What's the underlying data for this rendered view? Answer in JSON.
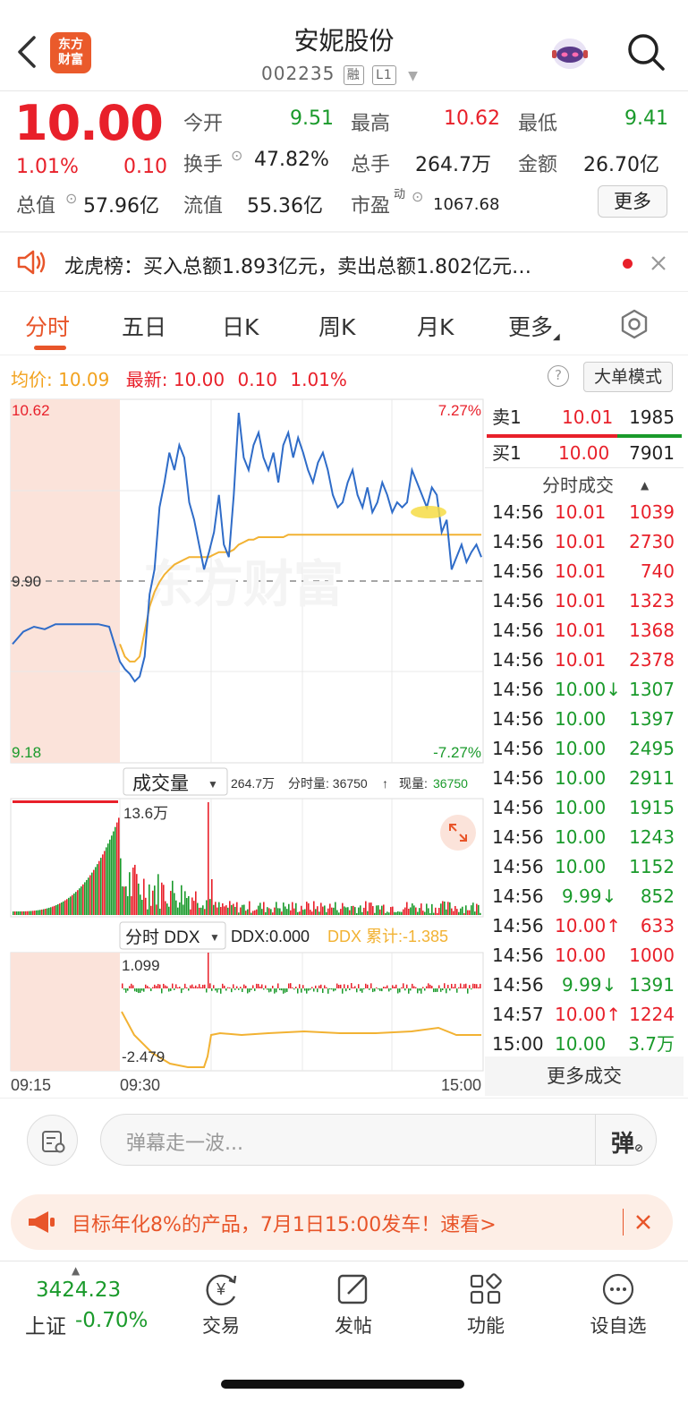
{
  "header": {
    "stock_name": "安妮股份",
    "stock_code": "002235",
    "tag_margin": "融",
    "tag_level": "L1",
    "logo_line1": "东方",
    "logo_line2": "财富"
  },
  "quote": {
    "price": "10.00",
    "change_pct": "1.01%",
    "change_amt": "0.10",
    "open_label": "今开",
    "open": "9.51",
    "high_label": "最高",
    "high": "10.62",
    "low_label": "最低",
    "low": "9.41",
    "turnover_label": "换手",
    "turnover": "47.82%",
    "volume_label": "总手",
    "volume": "264.7万",
    "amount_label": "金额",
    "amount": "26.70亿",
    "mcap_label": "总值",
    "mcap": "57.96亿",
    "float_label": "流值",
    "float_cap": "55.36亿",
    "pe_label": "市盈",
    "pe_sup": "动",
    "pe": "1067.68",
    "more_label": "更多"
  },
  "news": {
    "text": "龙虎榜：买入总额1.893亿元，卖出总额1.802亿元…"
  },
  "tabs": [
    "分时",
    "五日",
    "日K",
    "周K",
    "月K",
    "更多"
  ],
  "active_tab": "分时",
  "avg_line": {
    "avg_label": "均价:",
    "avg": "10.09",
    "last_label": "最新:",
    "last": "10.00",
    "chg": "0.10",
    "pct": "1.01%",
    "help": "?",
    "big_mode": "大单模式"
  },
  "chart_data": [
    {
      "type": "line",
      "title": "分时",
      "y_left_ticks": [
        "10.62",
        "9.90",
        "9.18"
      ],
      "y_right_ticks": [
        "7.27%",
        "-7.27%"
      ],
      "x_ticks": [
        "09:15",
        "09:30",
        "15:00"
      ],
      "ylim": [
        9.18,
        10.62
      ],
      "prev_close": 9.9,
      "series": [
        {
          "values": [
            9.65,
            9.7,
            9.72,
            9.71,
            9.73,
            9.73,
            9.73,
            9.73,
            9.73,
            9.72,
            9.58,
            9.55,
            9.53,
            9.5,
            9.52,
            9.6,
            9.85,
            9.95,
            10.2,
            10.3,
            10.42,
            10.35,
            10.45,
            10.4,
            10.22,
            10.15,
            10.05,
            9.95,
            10.02,
            10.1,
            10.25,
            10.05,
            10.0,
            10.25,
            10.58,
            10.4,
            10.35,
            10.45,
            10.5,
            10.4,
            10.35,
            10.42,
            10.3,
            10.45,
            10.5,
            10.4,
            10.48,
            10.42,
            10.35,
            10.3,
            10.38,
            10.42,
            10.35,
            10.25,
            10.2,
            10.22,
            10.3,
            10.35,
            10.25,
            10.2,
            10.28,
            10.18,
            10.22,
            10.3,
            10.25,
            10.18,
            10.22,
            10.2,
            10.22,
            10.35,
            10.3,
            10.25,
            10.2,
            10.28,
            10.25,
            10.1,
            10.15,
            9.95,
            10.0,
            10.05,
            9.98,
            10.02,
            10.05,
            10.0
          ]
        },
        {
          "values": [
            9.65,
            9.7,
            9.72,
            9.72,
            9.72,
            9.72,
            9.72,
            9.72,
            9.72,
            9.72,
            9.65,
            9.6,
            9.58,
            9.58,
            9.6,
            9.7,
            9.8,
            9.86,
            9.9,
            9.93,
            9.95,
            9.97,
            9.98,
            9.99,
            10.0,
            10.0,
            10.0,
            10.0,
            10.0,
            10.01,
            10.02,
            10.02,
            10.02,
            10.03,
            10.05,
            10.06,
            10.07,
            10.07,
            10.08,
            10.08,
            10.08,
            10.08,
            10.08,
            10.08,
            10.09,
            10.09,
            10.09,
            10.09,
            10.09,
            10.09,
            10.09,
            10.09,
            10.09,
            10.09,
            10.09,
            10.09,
            10.09,
            10.09,
            10.09,
            10.09,
            10.09,
            10.09,
            10.09,
            10.09,
            10.09,
            10.09,
            10.09,
            10.09,
            10.09,
            10.09,
            10.09,
            10.09,
            10.09,
            10.09,
            10.09,
            10.09,
            10.09,
            10.09,
            10.09,
            10.09,
            10.09,
            10.09,
            10.09,
            10.09
          ]
        }
      ]
    },
    {
      "type": "bar",
      "title": "成交量",
      "label_total": "264.7万",
      "label_minute": "分时量: 36750",
      "label_now": "现量:",
      "now_value": "36750",
      "y_max_label": "13.6万",
      "ylim": [
        0,
        13.6
      ]
    },
    {
      "type": "line",
      "title": "分时 DDX",
      "ddx_label": "DDX:0.000",
      "ddx_cum_label": "DDX 累计:-1.385",
      "y_max_label": "1.099",
      "y_min_label": "-2.479",
      "ylim": [
        -2.479,
        1.099
      ]
    }
  ],
  "orderbook": {
    "sell_label": "卖1",
    "sell_price": "10.01",
    "sell_vol": "1985",
    "buy_label": "买1",
    "buy_price": "10.00",
    "buy_vol": "7901",
    "trades_title": "分时成交",
    "more_trades": "更多成交",
    "trades": [
      {
        "time": "14:56",
        "price": "10.01",
        "arrow": "",
        "vol": "1039",
        "color": "red"
      },
      {
        "time": "14:56",
        "price": "10.01",
        "arrow": "",
        "vol": "2730",
        "color": "red"
      },
      {
        "time": "14:56",
        "price": "10.01",
        "arrow": "",
        "vol": "740",
        "color": "red"
      },
      {
        "time": "14:56",
        "price": "10.01",
        "arrow": "",
        "vol": "1323",
        "color": "red"
      },
      {
        "time": "14:56",
        "price": "10.01",
        "arrow": "",
        "vol": "1368",
        "color": "red"
      },
      {
        "time": "14:56",
        "price": "10.01",
        "arrow": "",
        "vol": "2378",
        "color": "red"
      },
      {
        "time": "14:56",
        "price": "10.00",
        "arrow": "↓",
        "vol": "1307",
        "color": "green"
      },
      {
        "time": "14:56",
        "price": "10.00",
        "arrow": "",
        "vol": "1397",
        "color": "green"
      },
      {
        "time": "14:56",
        "price": "10.00",
        "arrow": "",
        "vol": "2495",
        "color": "green"
      },
      {
        "time": "14:56",
        "price": "10.00",
        "arrow": "",
        "vol": "2911",
        "color": "green"
      },
      {
        "time": "14:56",
        "price": "10.00",
        "arrow": "",
        "vol": "1915",
        "color": "green"
      },
      {
        "time": "14:56",
        "price": "10.00",
        "arrow": "",
        "vol": "1243",
        "color": "green"
      },
      {
        "time": "14:56",
        "price": "10.00",
        "arrow": "",
        "vol": "1152",
        "color": "green"
      },
      {
        "time": "14:56",
        "price": "9.99",
        "arrow": "↓",
        "vol": "852",
        "color": "green"
      },
      {
        "time": "14:56",
        "price": "10.00",
        "arrow": "↑",
        "vol": "633",
        "color": "red"
      },
      {
        "time": "14:56",
        "price": "10.00",
        "arrow": "",
        "vol": "1000",
        "color": "red"
      },
      {
        "time": "14:56",
        "price": "9.99",
        "arrow": "↓",
        "vol": "1391",
        "color": "green"
      },
      {
        "time": "14:57",
        "price": "10.00",
        "arrow": "↑",
        "vol": "1224",
        "color": "red"
      },
      {
        "time": "15:00",
        "price": "10.00",
        "arrow": "",
        "vol": "3.7万",
        "color": "green"
      }
    ]
  },
  "danmu": {
    "placeholder": "弹幕走一波...",
    "button": "弹"
  },
  "promo": {
    "text": "目标年化8%的产品，7月1日15:00发车！速看>"
  },
  "bottom_nav": {
    "index_value": "3424.23",
    "index_name": "上证",
    "index_change": "-0.70%",
    "items": [
      "交易",
      "发帖",
      "功能",
      "设自选"
    ]
  },
  "watermark": "东方财富",
  "colors": {
    "up": "#e8202a",
    "down": "#1a9a2b",
    "accent": "#e8552a",
    "avg": "#f2b233",
    "price_line": "#2f6cc8"
  }
}
